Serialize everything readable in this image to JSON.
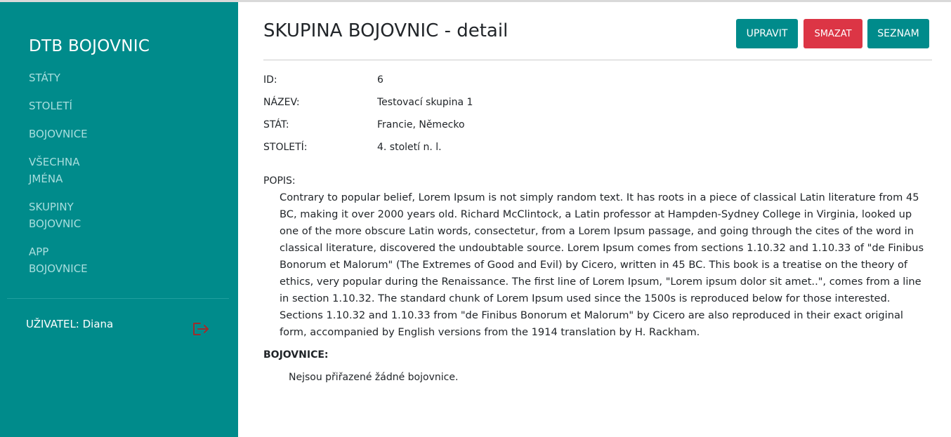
{
  "sidebar": {
    "brand": "DTB BOJOVNIC",
    "items": [
      {
        "label": "STÁTY"
      },
      {
        "label": "STOLETÍ"
      },
      {
        "label": "BOJOVNICE"
      },
      {
        "label": "VŠECHNA JMÉNA"
      },
      {
        "label": "SKUPINY BOJOVNIC"
      },
      {
        "label": "APP BOJOVNICE"
      }
    ],
    "user_label": "UŽIVATEL: Diana",
    "logout_icon": "logout-icon"
  },
  "header": {
    "title": "SKUPINA BOJOVNIC - detail",
    "buttons": {
      "edit": "UPRAVIT",
      "delete": "SMAZAT",
      "list": "SEZNAM"
    }
  },
  "colors": {
    "primary": "#008b8b",
    "danger": "#dc3545",
    "logout_icon": "#b22222"
  },
  "details": [
    {
      "label": "ID:",
      "value": "6"
    },
    {
      "label": "NÁZEV:",
      "value": "Testovací skupina 1"
    },
    {
      "label": "STÁT:",
      "value": "Francie, Německo"
    },
    {
      "label": "STOLETÍ:",
      "value": "4. století n. l."
    }
  ],
  "description": {
    "label": "POPIS:",
    "text": "Contrary to popular belief, Lorem Ipsum is not simply random text. It has roots in a piece of classical Latin literature from 45 BC, making it over 2000 years old. Richard McClintock, a Latin professor at Hampden-Sydney College in Virginia, looked up one of the more obscure Latin words, consectetur, from a Lorem Ipsum passage, and going through the cites of the word in classical literature, discovered the undoubtable source. Lorem Ipsum comes from sections 1.10.32 and 1.10.33 of \"de Finibus Bonorum et Malorum\" (The Extremes of Good and Evil) by Cicero, written in 45 BC. This book is a treatise on the theory of ethics, very popular during the Renaissance. The first line of Lorem Ipsum, \"Lorem ipsum dolor sit amet..\", comes from a line in section 1.10.32. The standard chunk of Lorem Ipsum used since the 1500s is reproduced below for those interested. Sections 1.10.32 and 1.10.33 from \"de Finibus Bonorum et Malorum\" by Cicero are also reproduced in their exact original form, accompanied by English versions from the 1914 translation by H. Rackham."
  },
  "fighters": {
    "label": "BOJOVNICE:",
    "empty_text": "Nejsou přiřazené žádné bojovnice."
  }
}
